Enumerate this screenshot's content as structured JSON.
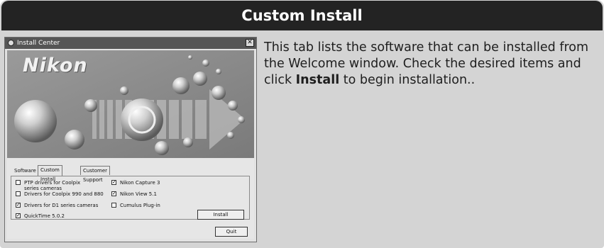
{
  "header": {
    "title": "Custom Install"
  },
  "description": {
    "before": "This tab lists the software that can be installed from the Welcome window.  Check the desired items and click ",
    "strong": "Install",
    "after": " to begin installation.."
  },
  "window": {
    "title": "Install Center",
    "close_glyph": "✕",
    "logo_text": "Nikon",
    "tabs": [
      {
        "label": "Software",
        "active": false
      },
      {
        "label": "Custom Install",
        "active": true
      },
      {
        "label": "Customer Support",
        "active": false
      }
    ],
    "options": [
      {
        "label": "PTP drivers for Coolpix series cameras",
        "checked": false
      },
      {
        "label": "Nikon Capture 3",
        "checked": true
      },
      {
        "label": "Drivers for Coolpix 990 and 880",
        "checked": false
      },
      {
        "label": "Nikon View 5.1",
        "checked": true
      },
      {
        "label": "Drivers for D1 series cameras",
        "checked": true
      },
      {
        "label": "Cumulus Plug-in",
        "checked": false
      },
      {
        "label": "QuickTime 5.0.2",
        "checked": true
      }
    ],
    "install_button": "Install",
    "quit_button": "Quit"
  },
  "colors": {
    "header_bg": "#232323",
    "page_bg": "#d4d4d4",
    "banner_bg": "#8a8a8a"
  }
}
